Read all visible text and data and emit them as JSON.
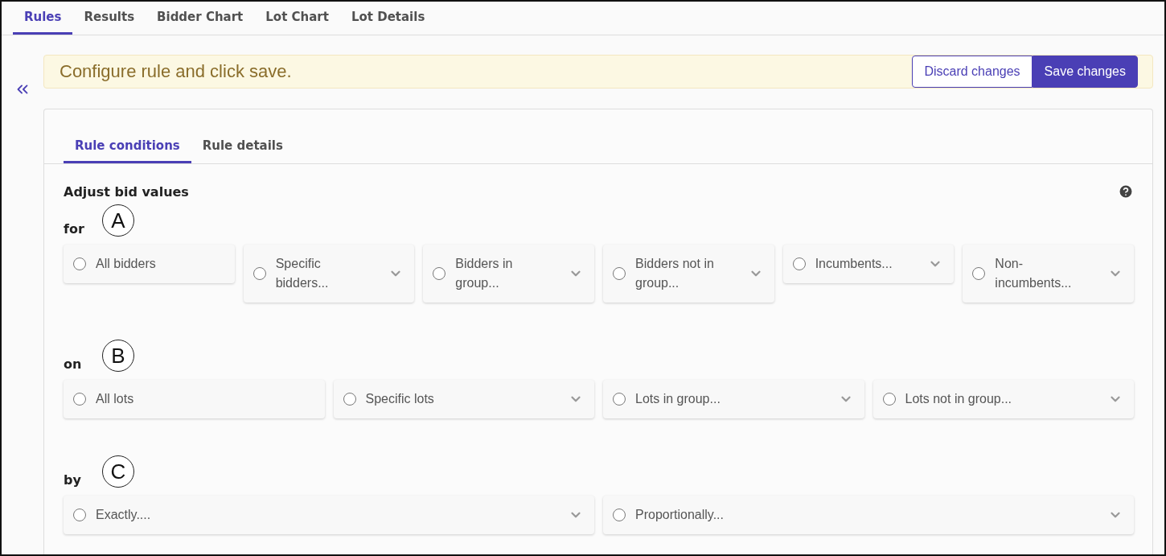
{
  "top_tabs": [
    {
      "label": "Rules",
      "selected": true
    },
    {
      "label": "Results",
      "selected": false
    },
    {
      "label": "Bidder Chart",
      "selected": false
    },
    {
      "label": "Lot Chart",
      "selected": false
    },
    {
      "label": "Lot Details",
      "selected": false
    }
  ],
  "banner": {
    "message": "Configure rule and click save.",
    "buttons": [
      {
        "label": "Discard changes",
        "kind": "secondary"
      },
      {
        "label": "Save changes",
        "kind": "primary"
      }
    ]
  },
  "card_tabs": [
    {
      "label": "Rule conditions",
      "selected": true
    },
    {
      "label": "Rule details",
      "selected": false
    }
  ],
  "heading": "Adjust bid values",
  "sections": [
    {
      "label": "for",
      "marker": "A",
      "options": [
        {
          "label": "All bidders",
          "selected": false,
          "dropdown": false
        },
        {
          "label": "Specific bidders...",
          "selected": false,
          "dropdown": true
        },
        {
          "label": "Bidders in group...",
          "selected": false,
          "dropdown": true
        },
        {
          "label": "Bidders not in group...",
          "selected": false,
          "dropdown": true
        },
        {
          "label": "Incumbents...",
          "selected": false,
          "dropdown": true
        },
        {
          "label": "Non-incumbents...",
          "selected": false,
          "dropdown": true
        }
      ]
    },
    {
      "label": "on",
      "marker": "B",
      "options": [
        {
          "label": "All lots",
          "selected": false,
          "dropdown": false
        },
        {
          "label": "Specific lots",
          "selected": false,
          "dropdown": true
        },
        {
          "label": "Lots in group...",
          "selected": false,
          "dropdown": true
        },
        {
          "label": "Lots not in group...",
          "selected": false,
          "dropdown": true
        }
      ]
    },
    {
      "label": "by",
      "marker": "C",
      "options": [
        {
          "label": "Exactly....",
          "selected": false,
          "dropdown": true
        },
        {
          "label": "Proportionally...",
          "selected": false,
          "dropdown": true
        }
      ]
    }
  ]
}
